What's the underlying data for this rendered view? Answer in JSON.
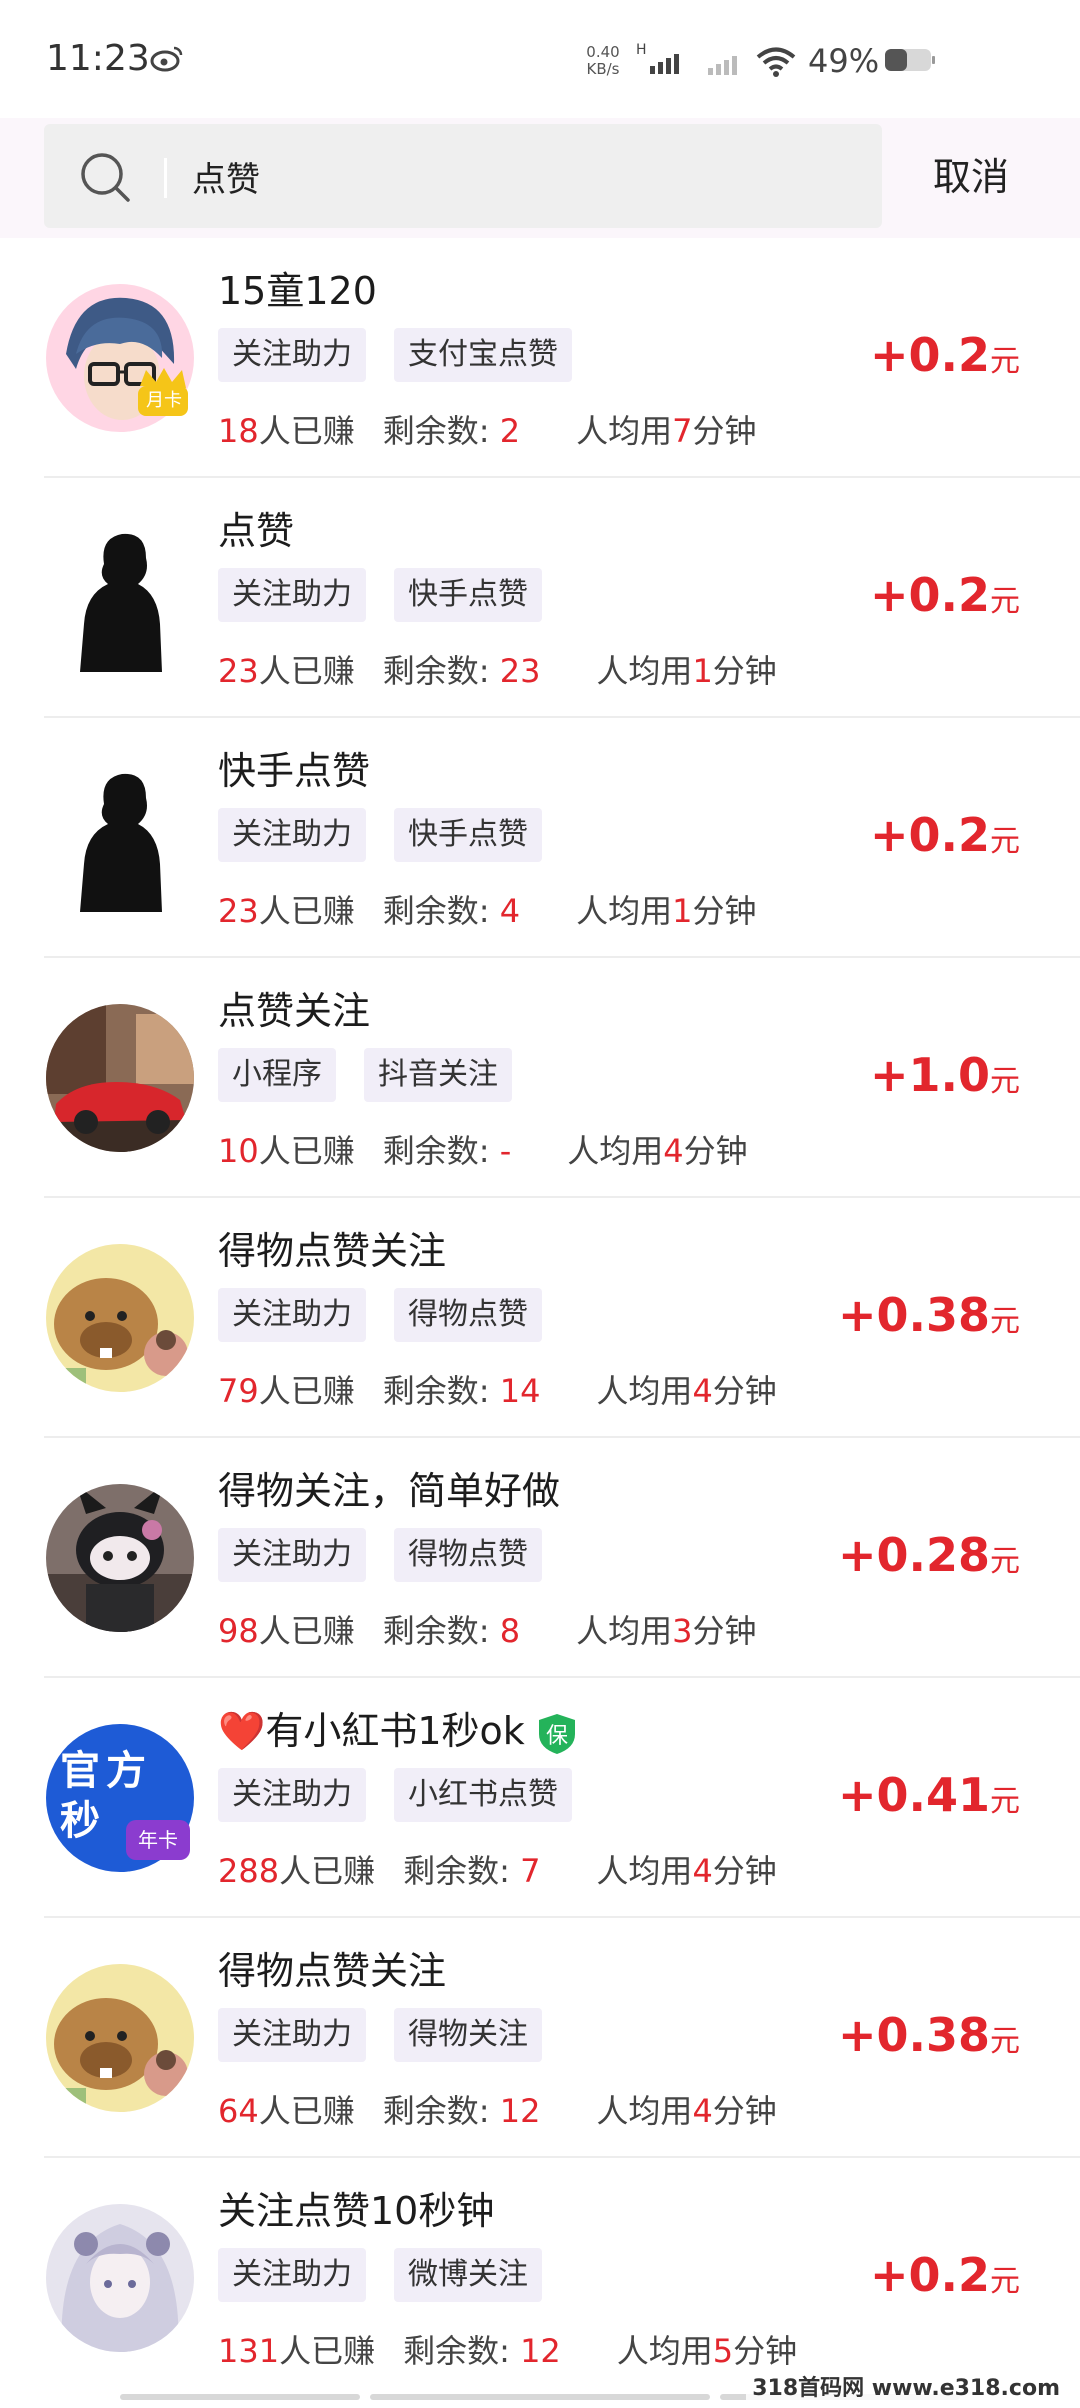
{
  "status_bar": {
    "time": "11:23",
    "net_speed_value": "0.40",
    "net_speed_unit": "KB/s",
    "battery_percent": "49%",
    "icons": [
      "weibo-icon",
      "signal-h-icon",
      "signal-icon",
      "wifi-icon",
      "battery-icon"
    ]
  },
  "search": {
    "query": "点赞",
    "cancel_label": "取消"
  },
  "tasks": [
    {
      "title": "15童120",
      "tags": [
        "关注助力",
        "支付宝点赞"
      ],
      "earned": "18",
      "earned_label": "人已赚",
      "remaining_label": "剩余数: ",
      "remaining": "2",
      "avg_prefix": "人均用",
      "avg_minutes": "7",
      "avg_suffix": "分钟",
      "reward": "+0.2",
      "unit": "元",
      "badge": "月卡"
    },
    {
      "title": "点赞",
      "tags": [
        "关注助力",
        "快手点赞"
      ],
      "earned": "23",
      "earned_label": "人已赚",
      "remaining_label": "剩余数: ",
      "remaining": "23",
      "avg_prefix": "人均用",
      "avg_minutes": "1",
      "avg_suffix": "分钟",
      "reward": "+0.2",
      "unit": "元"
    },
    {
      "title": "快手点赞",
      "tags": [
        "关注助力",
        "快手点赞"
      ],
      "earned": "23",
      "earned_label": "人已赚",
      "remaining_label": "剩余数: ",
      "remaining": "4",
      "avg_prefix": "人均用",
      "avg_minutes": "1",
      "avg_suffix": "分钟",
      "reward": "+0.2",
      "unit": "元"
    },
    {
      "title": "点赞关注",
      "tags": [
        "小程序",
        "抖音关注"
      ],
      "earned": "10",
      "earned_label": "人已赚",
      "remaining_label": "剩余数: ",
      "remaining": "-",
      "avg_prefix": "人均用",
      "avg_minutes": "4",
      "avg_suffix": "分钟",
      "reward": "+1.0",
      "unit": "元"
    },
    {
      "title": "得物点赞关注",
      "tags": [
        "关注助力",
        "得物点赞"
      ],
      "earned": "79",
      "earned_label": "人已赚",
      "remaining_label": "剩余数: ",
      "remaining": "14",
      "avg_prefix": "人均用",
      "avg_minutes": "4",
      "avg_suffix": "分钟",
      "reward": "+0.38",
      "unit": "元"
    },
    {
      "title": "得物关注，简单好做",
      "tags": [
        "关注助力",
        "得物点赞"
      ],
      "earned": "98",
      "earned_label": "人已赚",
      "remaining_label": "剩余数: ",
      "remaining": "8",
      "avg_prefix": "人均用",
      "avg_minutes": "3",
      "avg_suffix": "分钟",
      "reward": "+0.28",
      "unit": "元"
    },
    {
      "title": "❤️有小紅书1秒ok",
      "tags": [
        "关注助力",
        "小红书点赞"
      ],
      "earned": "288",
      "earned_label": "人已赚",
      "remaining_label": "剩余数: ",
      "remaining": "7",
      "avg_prefix": "人均用",
      "avg_minutes": "4",
      "avg_suffix": "分钟",
      "reward": "+0.41",
      "unit": "元",
      "shield_label": "保",
      "avatar_text": "官方秒",
      "badge": "年卡"
    },
    {
      "title": "得物点赞关注",
      "tags": [
        "关注助力",
        "得物关注"
      ],
      "earned": "64",
      "earned_label": "人已赚",
      "remaining_label": "剩余数: ",
      "remaining": "12",
      "avg_prefix": "人均用",
      "avg_minutes": "4",
      "avg_suffix": "分钟",
      "reward": "+0.38",
      "unit": "元"
    },
    {
      "title": "关注点赞10秒钟",
      "tags": [
        "关注助力",
        "微博关注"
      ],
      "earned": "131",
      "earned_label": "人已赚",
      "remaining_label": "剩余数: ",
      "remaining": "12",
      "avg_prefix": "人均用",
      "avg_minutes": "5",
      "avg_suffix": "分钟",
      "reward": "+0.2",
      "unit": "元"
    }
  ],
  "watermark": "318首码网 www.e318.com",
  "colors": {
    "accent_red": "#e2262d",
    "tag_bg": "#f1eef8",
    "search_bg": "#efefef"
  }
}
